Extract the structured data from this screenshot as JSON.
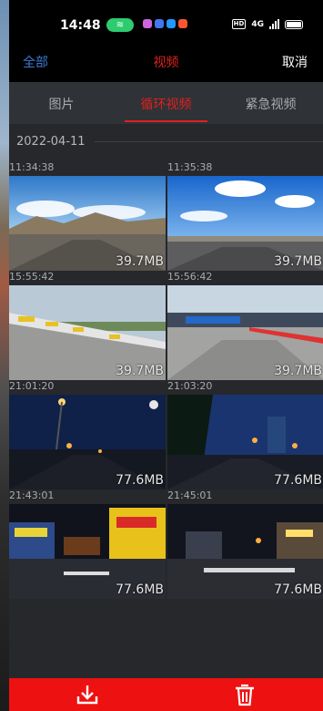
{
  "status_bar": {
    "time": "14:48",
    "hotspot_glyph": "≋",
    "hd_label": "HD",
    "network_label": "4G",
    "app_dot_colors": [
      "#cc66dd",
      "#4477ee",
      "#2299ff",
      "#ff5533"
    ]
  },
  "nav": {
    "left_label": "全部",
    "title": "视频",
    "right_label": "取消"
  },
  "tabs": [
    {
      "label": "图片",
      "active": false
    },
    {
      "label": "循环视频",
      "active": true
    },
    {
      "label": "紧急视频",
      "active": false
    }
  ],
  "date_group": "2022-04-11",
  "videos": [
    {
      "time": "11:34:38",
      "size": "39.7MB",
      "scene": "day-mountain"
    },
    {
      "time": "11:35:38",
      "size": "39.7MB",
      "scene": "day-sky"
    },
    {
      "time": "15:55:42",
      "size": "39.7MB",
      "scene": "track-barrier"
    },
    {
      "time": "15:56:42",
      "size": "39.7MB",
      "scene": "track-stands"
    },
    {
      "time": "21:01:20",
      "size": "77.6MB",
      "scene": "night-street"
    },
    {
      "time": "21:03:20",
      "size": "77.6MB",
      "scene": "night-city"
    },
    {
      "time": "21:43:01",
      "size": "77.6MB",
      "scene": "night-shops"
    },
    {
      "time": "21:45:01",
      "size": "77.6MB",
      "scene": "night-shops-2"
    }
  ],
  "actions": {
    "download_icon": "download-icon",
    "delete_icon": "trash-icon"
  },
  "colors": {
    "accent_red": "#e02020",
    "action_bar": "#ee1111",
    "nav_link_blue": "#3a7bd5"
  }
}
